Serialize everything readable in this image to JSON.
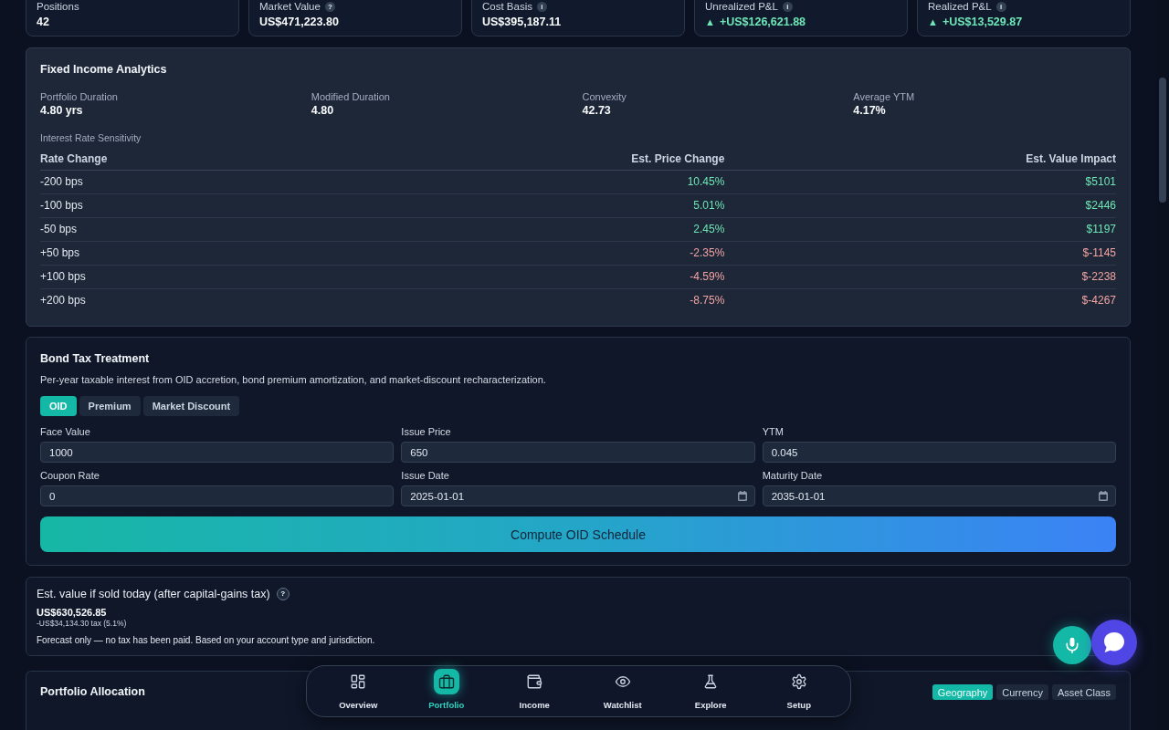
{
  "summary_cards": [
    {
      "label": "Positions",
      "value": "42"
    },
    {
      "label": "Market Value",
      "hint": "?",
      "value": "US$471,223.80"
    },
    {
      "label": "Cost Basis",
      "hint": "i",
      "value": "US$395,187.11"
    },
    {
      "label": "Unrealized P&L",
      "hint": "i",
      "arrow": "▲",
      "color": "#6ee7b7",
      "value": "+US$126,621.88"
    },
    {
      "label": "Realized P&L",
      "hint": "i",
      "arrow": "▲",
      "color": "#6ee7b7",
      "value": "+US$13,529.87"
    }
  ],
  "fixed_income": {
    "title": "Fixed Income Analytics",
    "metrics": [
      {
        "label": "Portfolio Duration",
        "value": "4.80 yrs"
      },
      {
        "label": "Modified Duration",
        "value": "4.80"
      },
      {
        "label": "Convexity",
        "value": "42.73"
      },
      {
        "label": "Average YTM",
        "value": "4.17%"
      }
    ],
    "sensitivity": {
      "title": "Interest Rate Sensitivity",
      "columns": [
        "Rate Change",
        "Est. Price Change",
        "Est. Value Impact"
      ],
      "rows": [
        {
          "rate_change": "-200 bps",
          "price_change": "10.45%",
          "value_impact": "$5101",
          "color": "#6ee7b7"
        },
        {
          "rate_change": "-100 bps",
          "price_change": "5.01%",
          "value_impact": "$2446",
          "color": "#6ee7b7"
        },
        {
          "rate_change": "-50 bps",
          "price_change": "2.45%",
          "value_impact": "$1197",
          "color": "#6ee7b7"
        },
        {
          "rate_change": "+50 bps",
          "price_change": "-2.35%",
          "value_impact": "$-1145",
          "color": "#f4a3a3"
        },
        {
          "rate_change": "+100 bps",
          "price_change": "-4.59%",
          "value_impact": "$-2238",
          "color": "#f4a3a3"
        },
        {
          "rate_change": "+200 bps",
          "price_change": "-8.75%",
          "value_impact": "$-4267",
          "color": "#f4a3a3"
        }
      ]
    }
  },
  "bond_tax": {
    "title": "Bond Tax Treatment",
    "description": "Per-year taxable interest from OID accretion, bond premium amortization, and market-discount recharacterization.",
    "tabs": [
      {
        "label": "OID",
        "selected": true
      },
      {
        "label": "Premium",
        "selected": false
      },
      {
        "label": "Market Discount",
        "selected": false
      }
    ],
    "fields": [
      {
        "label": "Face Value",
        "kind": "text",
        "value": "1000"
      },
      {
        "label": "Issue Price",
        "kind": "text",
        "value": "650"
      },
      {
        "label": "YTM",
        "kind": "text",
        "value": "0.045"
      },
      {
        "label": "Coupon Rate",
        "kind": "text",
        "value": "0"
      },
      {
        "label": "Issue Date",
        "kind": "date",
        "value": "2025-01-01"
      },
      {
        "label": "Maturity Date",
        "kind": "date",
        "value": "2035-01-01"
      }
    ],
    "button": "Compute OID Schedule"
  },
  "sale_estimate": {
    "title": "Est. value if sold today (after capital-gains tax)",
    "hint": "?",
    "value": "US$630,526.85",
    "tax": "-US$34,134.30 tax (5.1%)",
    "note": "Forecast only — no tax has been paid. Based on your account type and jurisdiction."
  },
  "allocation": {
    "title": "Portfolio Allocation",
    "tabs": [
      {
        "label": "Geography",
        "selected": true
      },
      {
        "label": "Currency",
        "selected": false
      },
      {
        "label": "Asset Class",
        "selected": false
      }
    ]
  },
  "bottom_nav": {
    "items": [
      {
        "label": "Overview",
        "selected": false
      },
      {
        "label": "Portfolio",
        "selected": true
      },
      {
        "label": "Income",
        "selected": false
      },
      {
        "label": "Watchlist",
        "selected": false
      },
      {
        "label": "Explore",
        "selected": false
      },
      {
        "label": "Setup",
        "selected": false
      }
    ]
  }
}
